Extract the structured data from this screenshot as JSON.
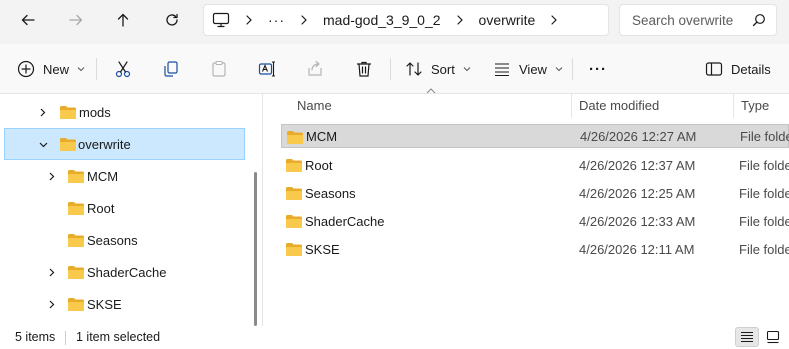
{
  "nav": {
    "back_icon": "arrow-left-icon",
    "forward_icon": "arrow-right-icon",
    "up_icon": "arrow-up-icon",
    "refresh_icon": "refresh-icon"
  },
  "breadcrumb": {
    "items": [
      "mad-god_3_9_0_2",
      "overwrite"
    ],
    "overflow": "···"
  },
  "search": {
    "placeholder": "Search overwrite"
  },
  "toolbar": {
    "new_label": "New",
    "sort_label": "Sort",
    "view_label": "View",
    "more_label": "···",
    "details_label": "Details"
  },
  "sidebar": {
    "items": [
      {
        "label": "mods",
        "expandable": true,
        "expanded": false,
        "selected": false
      },
      {
        "label": "overwrite",
        "expandable": true,
        "expanded": true,
        "selected": true
      },
      {
        "label": "MCM",
        "expandable": true,
        "expanded": false,
        "selected": false
      },
      {
        "label": "Root",
        "expandable": false,
        "expanded": false,
        "selected": false
      },
      {
        "label": "Seasons",
        "expandable": false,
        "expanded": false,
        "selected": false
      },
      {
        "label": "ShaderCache",
        "expandable": true,
        "expanded": false,
        "selected": false
      },
      {
        "label": "SKSE",
        "expandable": true,
        "expanded": false,
        "selected": false
      }
    ]
  },
  "file_list": {
    "columns": [
      "Name",
      "Date modified",
      "Type"
    ],
    "rows": [
      {
        "name": "MCM",
        "date": "4/26/2026 12:27 AM",
        "type": "File folder",
        "selected": true
      },
      {
        "name": "Root",
        "date": "4/26/2026 12:37 AM",
        "type": "File folder",
        "selected": false
      },
      {
        "name": "Seasons",
        "date": "4/26/2026 12:25 AM",
        "type": "File folder",
        "selected": false
      },
      {
        "name": "ShaderCache",
        "date": "4/26/2026 12:33 AM",
        "type": "File folder",
        "selected": false
      },
      {
        "name": "SKSE",
        "date": "4/26/2026 12:11 AM",
        "type": "File folder",
        "selected": false
      }
    ]
  },
  "status": {
    "item_count": "5 items",
    "selection": "1 item selected"
  },
  "colors": {
    "folder": "#f8c94a",
    "folder_dark": "#e9ac2a",
    "accent": "#0067c0",
    "nav_selected_bg": "#cce8ff",
    "row_selected_bg": "#d9d9d9"
  }
}
